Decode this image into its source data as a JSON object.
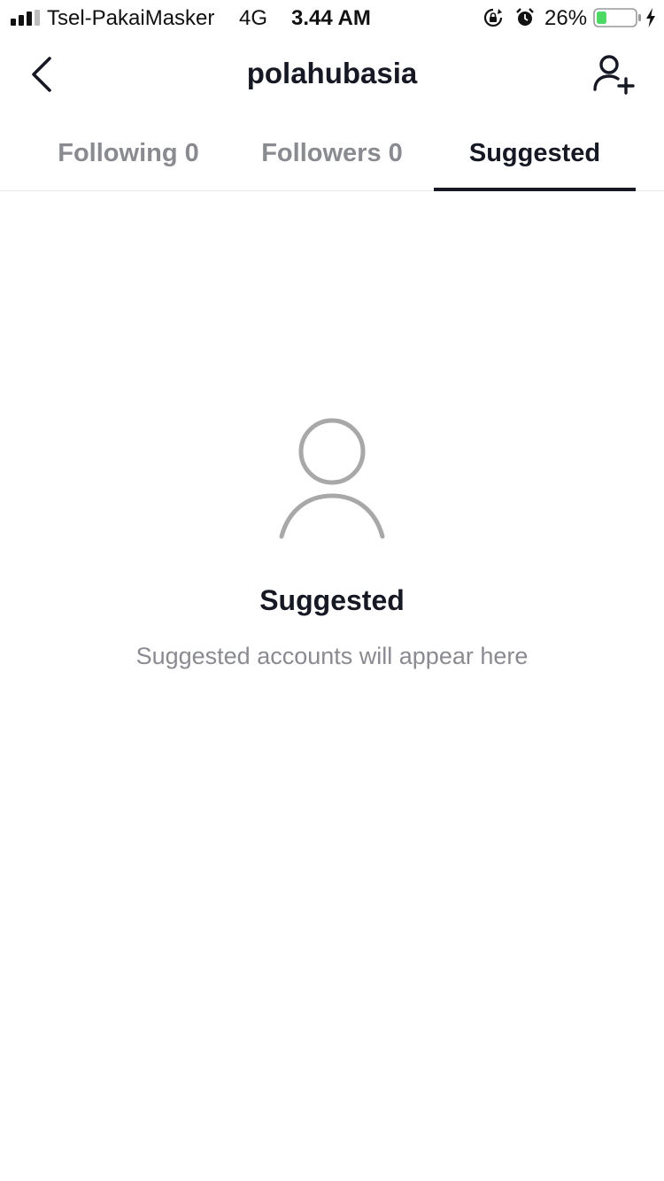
{
  "status_bar": {
    "carrier": "Tsel-PakaiMasker",
    "network": "4G",
    "time": "3.44 AM",
    "battery_percent": "26%",
    "battery_level": 0.26,
    "battery_color": "#4cd964"
  },
  "header": {
    "title": "polahubasia",
    "back_icon": "chevron-left-icon",
    "add_user_icon": "add-user-icon"
  },
  "tabs": [
    {
      "label": "Following 0",
      "active": false
    },
    {
      "label": "Followers 0",
      "active": false
    },
    {
      "label": "Suggested",
      "active": true
    }
  ],
  "empty_state": {
    "icon": "person-outline-icon",
    "title": "Suggested",
    "subtitle": "Suggested accounts will appear here"
  },
  "colors": {
    "text_primary": "#161823",
    "text_secondary": "#8a8b91",
    "icon_gray": "#a8a8a8",
    "divider": "#e6e6e8"
  }
}
